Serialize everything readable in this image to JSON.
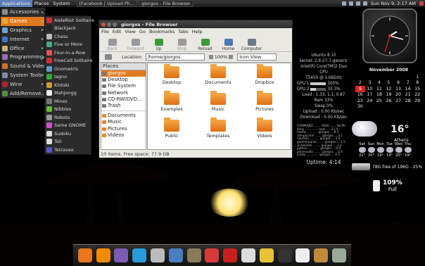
{
  "top_panel": {
    "menus": [
      "Applications",
      "Places",
      "System"
    ],
    "tasks": [
      "[Facebook | Upload Ph...",
      "giorgos - File Browser"
    ],
    "clock": "Sun Nov 9, 2:17 AM"
  },
  "applications_menu": {
    "items": [
      {
        "label": "Accessories",
        "color": "#8a8a8a",
        "submenu": true,
        "selected": false
      },
      {
        "label": "Games",
        "color": "#e5a83a",
        "submenu": true,
        "selected": true
      },
      {
        "label": "Graphics",
        "color": "#6aa7d8",
        "submenu": true,
        "selected": false
      },
      {
        "label": "Internet",
        "color": "#3a78c9",
        "submenu": true,
        "selected": false
      },
      {
        "label": "Office",
        "color": "#ccb07a",
        "submenu": true,
        "selected": false
      },
      {
        "label": "Programming",
        "color": "#9a6ab5",
        "submenu": true,
        "selected": false
      },
      {
        "label": "Sound & Video",
        "color": "#d96f28",
        "submenu": true,
        "selected": false
      },
      {
        "label": "System Tools",
        "color": "#7a8ea3",
        "submenu": true,
        "selected": false
      },
      {
        "label": "Wine",
        "color": "#b0222a",
        "submenu": true,
        "selected": false
      },
      {
        "label": "Add/Remove...",
        "color": "#4f8f3d",
        "submenu": false,
        "selected": false
      }
    ]
  },
  "games_menu": {
    "items": [
      {
        "label": "AisleRiot Solitaire",
        "color": "#c33"
      },
      {
        "label": "Blackjack",
        "color": "#222"
      },
      {
        "label": "Chess",
        "color": "#bbb"
      },
      {
        "label": "Five or More",
        "color": "#4a8"
      },
      {
        "label": "Four-in-a-Row",
        "color": "#d55"
      },
      {
        "label": "FreeCell Solitaire",
        "color": "#c33"
      },
      {
        "label": "Gnometris",
        "color": "#69c"
      },
      {
        "label": "Iagno",
        "color": "#3a3"
      },
      {
        "label": "Klotski",
        "color": "#c93"
      },
      {
        "label": "Mahjongg",
        "color": "#eee"
      },
      {
        "label": "Mines",
        "color": "#777"
      },
      {
        "label": "Nibbles",
        "color": "#6b3"
      },
      {
        "label": "Robots",
        "color": "#999"
      },
      {
        "label": "Same GNOME",
        "color": "#c5c"
      },
      {
        "label": "Sudoku",
        "color": "#ddd"
      },
      {
        "label": "Tali",
        "color": "#ddd"
      },
      {
        "label": "Tetravex",
        "color": "#55c"
      }
    ]
  },
  "file_browser": {
    "title": "giorgos - File Browser",
    "menu": [
      "File",
      "Edit",
      "View",
      "Go",
      "Bookmarks",
      "Tabs",
      "Help"
    ],
    "toolbar": [
      {
        "label": "Back",
        "disabled": true,
        "color": "#999"
      },
      {
        "label": "Forward",
        "disabled": true,
        "color": "#999"
      },
      {
        "label": "Up",
        "disabled": false,
        "color": "#3a9a3a"
      },
      {
        "label": "Stop",
        "disabled": true,
        "color": "#999"
      },
      {
        "label": "Reload",
        "disabled": false,
        "color": "#3a9a3a"
      },
      {
        "label": "Home",
        "disabled": false,
        "color": "#4a78b8"
      },
      {
        "label": "Computer",
        "disabled": false,
        "color": "#6a7a8a"
      }
    ],
    "location_label": "Location:",
    "location_value": "/home/giorgos",
    "zoom": "100%",
    "view_mode": "Icon View",
    "sidebar_header": "Places",
    "places": [
      "giorgos",
      "Desktop",
      "File System",
      "Network",
      "CD-RW/DVD...",
      "Trash"
    ],
    "bookmarks": [
      "Documents",
      "Music",
      "Pictures",
      "Videos"
    ],
    "folders": [
      "Desktop",
      "Documents",
      "Dropbox",
      "Examples",
      "Music",
      "Pictures",
      "Public",
      "Templates",
      "Videos"
    ],
    "status": "10 items, Free space: 77.9 GB"
  },
  "conky": {
    "distro": "Ubuntu 8.10",
    "kernel": "kernel: 2.6.27-7-generic",
    "cpu_model": "Intel(R) Core(TM)2 Duo CPU",
    "cpu_freq": "T5450 @ 1.66GHz",
    "gpu1_label": "GPU 1",
    "gpu1": "100%",
    "gpu2_label": "GPU 2",
    "gpu2": "33.3%",
    "load": "Load : 1.33, 1.1, 0.87",
    "ram": "Ram 33%",
    "swap": "Swap 0%",
    "upload": "Upload : 0.00 Kb/sec",
    "download": "Download : 0.00 Kb/sec",
    "processes": [
      "COMMAND ....... USER .......%CPU",
      "Xorg .............. root ......12.4",
      "firefox ........... giorgos ....8.3",
      "compiz.real ....... giorgos ....4.1",
      "nautilus .......... giorgos ....2.0",
      "gnome-panel ....... giorgos ....1.5",
      "screenlets ........ giorgos ....1.2",
      "python ............ giorgos ....0.9",
      "pulseaudio ........ giorgos ....0.6",
      "conky ............. giorgos ....0.5"
    ],
    "uptime": "Uptime: 4:14"
  },
  "calendar": {
    "month": "November 2008",
    "rows": [
      [
        "",
        "",
        "",
        "",
        "",
        "",
        "1"
      ],
      [
        "2",
        "3",
        "4",
        "5",
        "6",
        "7",
        "8"
      ],
      [
        "9",
        "10",
        "11",
        "12",
        "13",
        "14",
        "15"
      ],
      [
        "16",
        "17",
        "18",
        "19",
        "20",
        "21",
        "22"
      ],
      [
        "23",
        "24",
        "25",
        "26",
        "27",
        "28",
        "29"
      ],
      [
        "30",
        "",
        "",
        "",
        "",
        "",
        ""
      ]
    ],
    "today": "9"
  },
  "weather": {
    "temperature": "16°",
    "city": "Athens",
    "days": [
      "Sat",
      "Sun",
      "Mon",
      "Tue",
      "Wed",
      "Thu"
    ],
    "highs": [
      "21°",
      "20°",
      "19°",
      "19°",
      "20°",
      "19°"
    ]
  },
  "hdd": {
    "text": "78G free of 196G - 25%"
  },
  "battery": {
    "percent": "109%",
    "status": "Full"
  },
  "dock": {
    "icons": [
      {
        "name": "firefox-icon",
        "color": "#e8761c"
      },
      {
        "name": "vlc-icon",
        "color": "#f08a00"
      },
      {
        "name": "pidgin-icon",
        "color": "#7b5bb7"
      },
      {
        "name": "skype-icon",
        "color": "#2a9ad8"
      },
      {
        "name": "usb-device-icon",
        "color": "#bbbbbb"
      },
      {
        "name": "network-icon",
        "color": "#4a7ec0"
      },
      {
        "name": "gimp-icon",
        "color": "#8a7a5a"
      },
      {
        "name": "picasa-icon",
        "color": "#d63a3a"
      },
      {
        "name": "book-icon",
        "color": "#c8201e"
      },
      {
        "name": "cd-burner-icon",
        "color": "#dddddd"
      },
      {
        "name": "chat-icon",
        "color": "#e8c23a"
      },
      {
        "name": "terminal-icon",
        "color": "#333333"
      },
      {
        "name": "text-editor-icon",
        "color": "#eeeeee"
      },
      {
        "name": "package-icon",
        "color": "#c08a3a"
      },
      {
        "name": "trash-icon",
        "color": "#99aa99"
      }
    ]
  }
}
